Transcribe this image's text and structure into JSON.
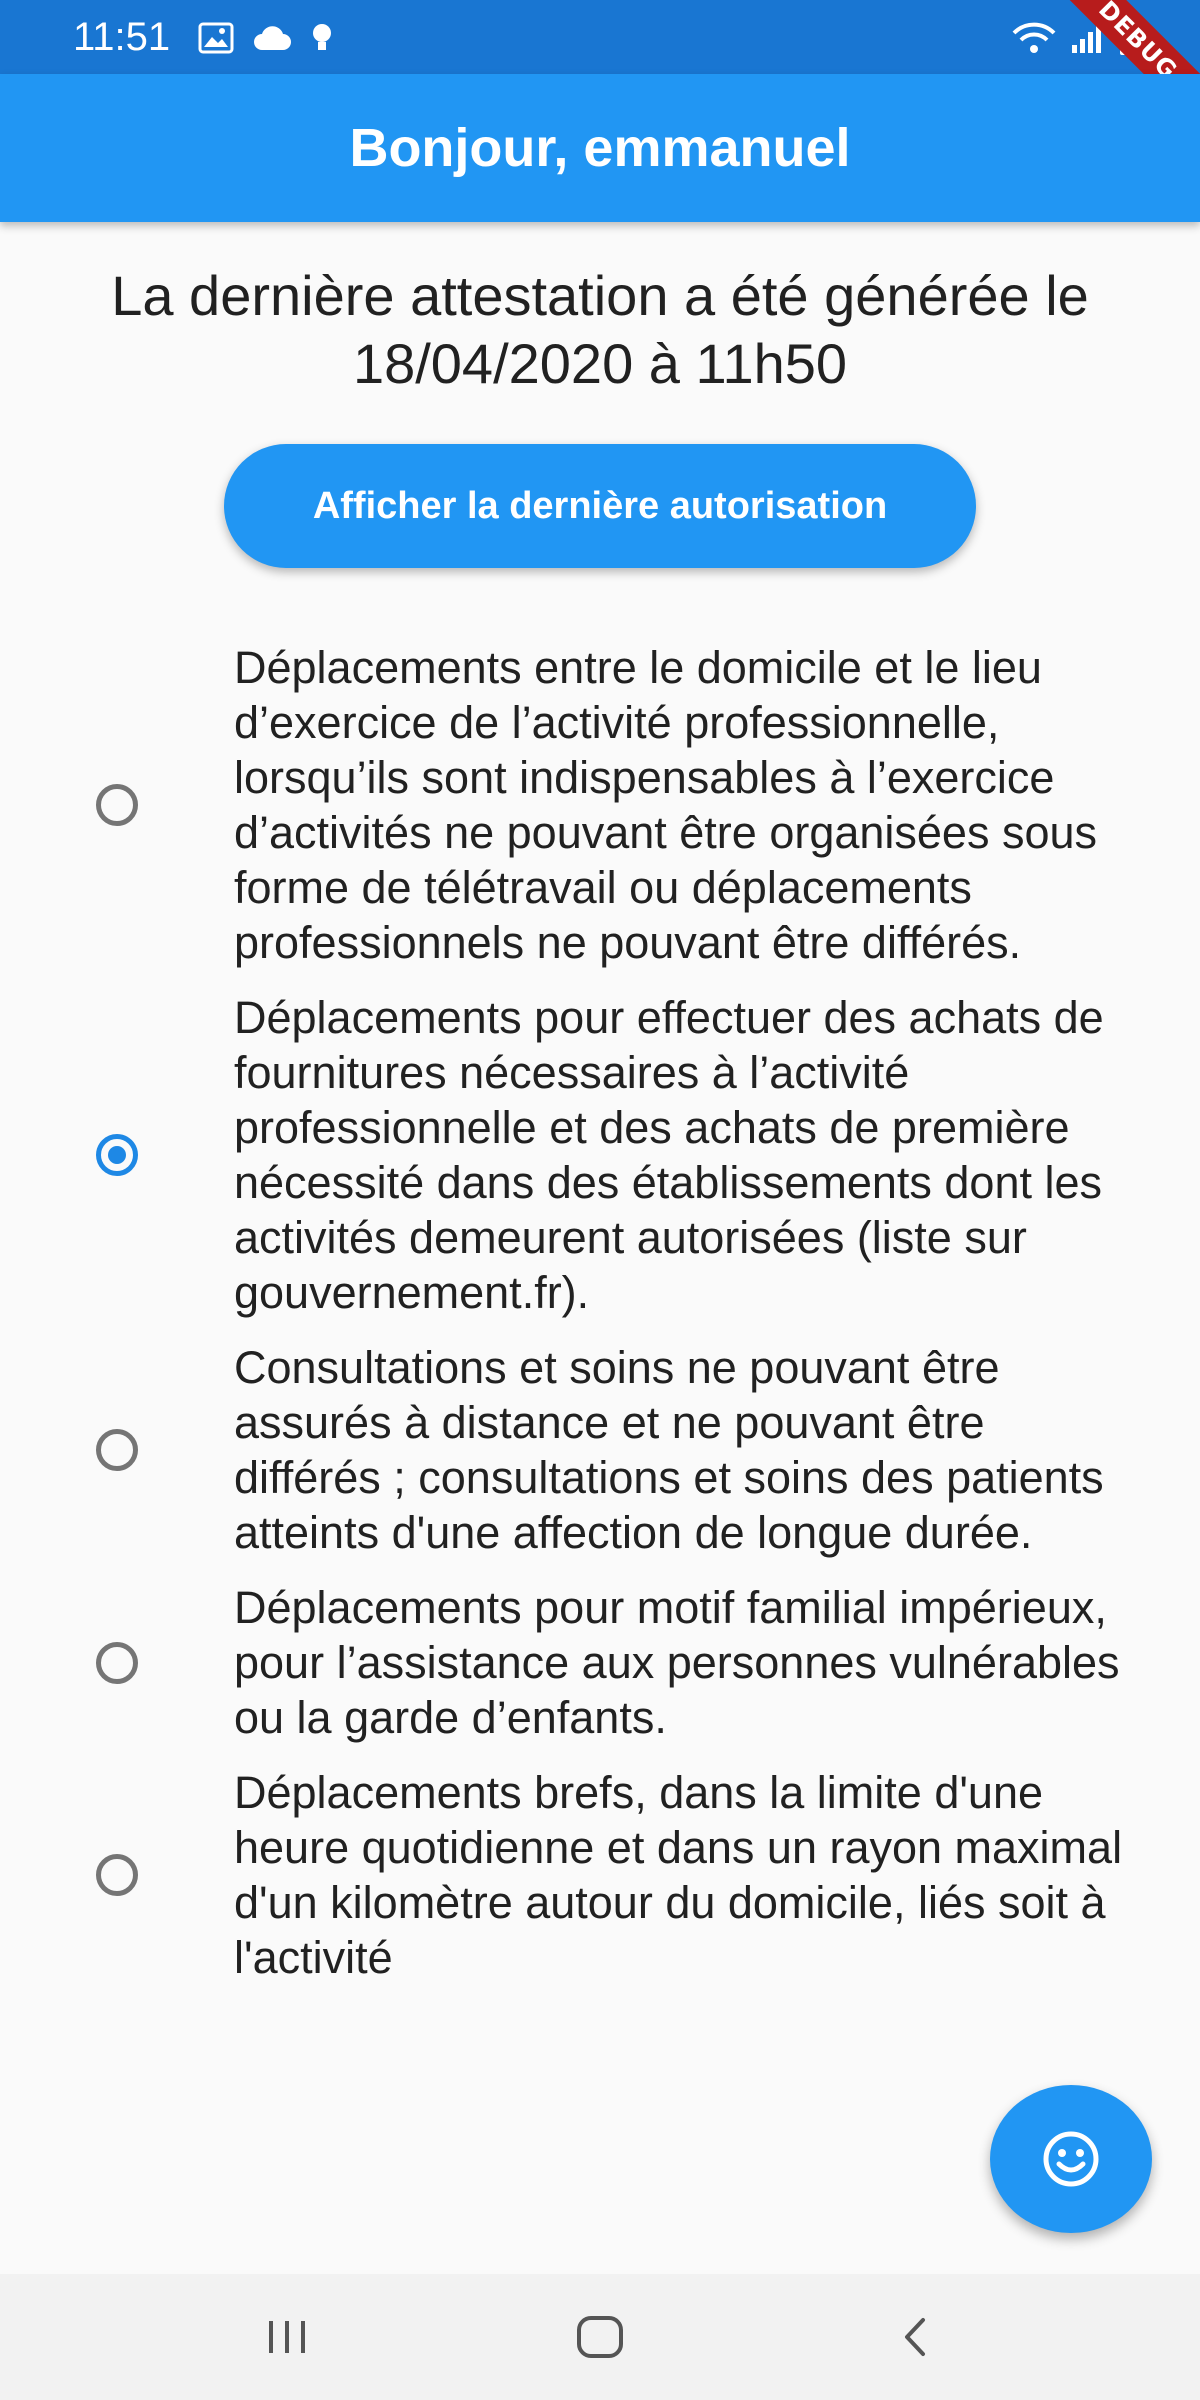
{
  "status_bar": {
    "time": "11:51",
    "icons_left": [
      "image-icon",
      "cloud-icon",
      "bulb-icon"
    ],
    "icons_right": [
      "wifi-icon",
      "signal-icon",
      "battery-icon"
    ],
    "debug_label": "DEBUG"
  },
  "app_bar": {
    "title": "Bonjour, emmanuel"
  },
  "headline": "La dernière attestation a été générée le 18/04/2020 à 11h50",
  "show_last_button": "Afficher la dernière autorisation",
  "options": [
    {
      "text": "Déplacements entre le domicile et le lieu d’exercice de l’activité professionnelle, lorsqu’ils sont indispensables à l’exercice d’activités ne pouvant être organisées sous forme de télétravail ou déplacements professionnels ne pouvant être différés.",
      "selected": false
    },
    {
      "text": "Déplacements pour effectuer des achats de fournitures nécessaires à l’activité professionnelle et des achats de première nécessité dans des établissements dont les activités demeurent autorisées (liste sur gouvernement.fr).",
      "selected": true
    },
    {
      "text": "Consultations et soins ne pouvant être assurés à distance et ne pouvant être différés ; consultations et soins des patients atteints d'une affection de longue durée.",
      "selected": false
    },
    {
      "text": "Déplacements pour motif familial impérieux, pour l’assistance aux personnes vulnérables ou la garde d’enfants.",
      "selected": false
    },
    {
      "text": "Déplacements brefs, dans la limite d'une heure quotidienne et dans un rayon maximal d'un kilomètre autour du domicile, liés soit à l'activité",
      "selected": false
    }
  ],
  "fab_icon": "smiley-icon",
  "nav_bar": [
    "recent-apps-icon",
    "home-icon",
    "back-icon"
  ],
  "colors": {
    "primary": "#2196f3",
    "status_bar": "#1976d2",
    "radio_selected": "#1e88e5",
    "radio_unselected": "#757575"
  }
}
